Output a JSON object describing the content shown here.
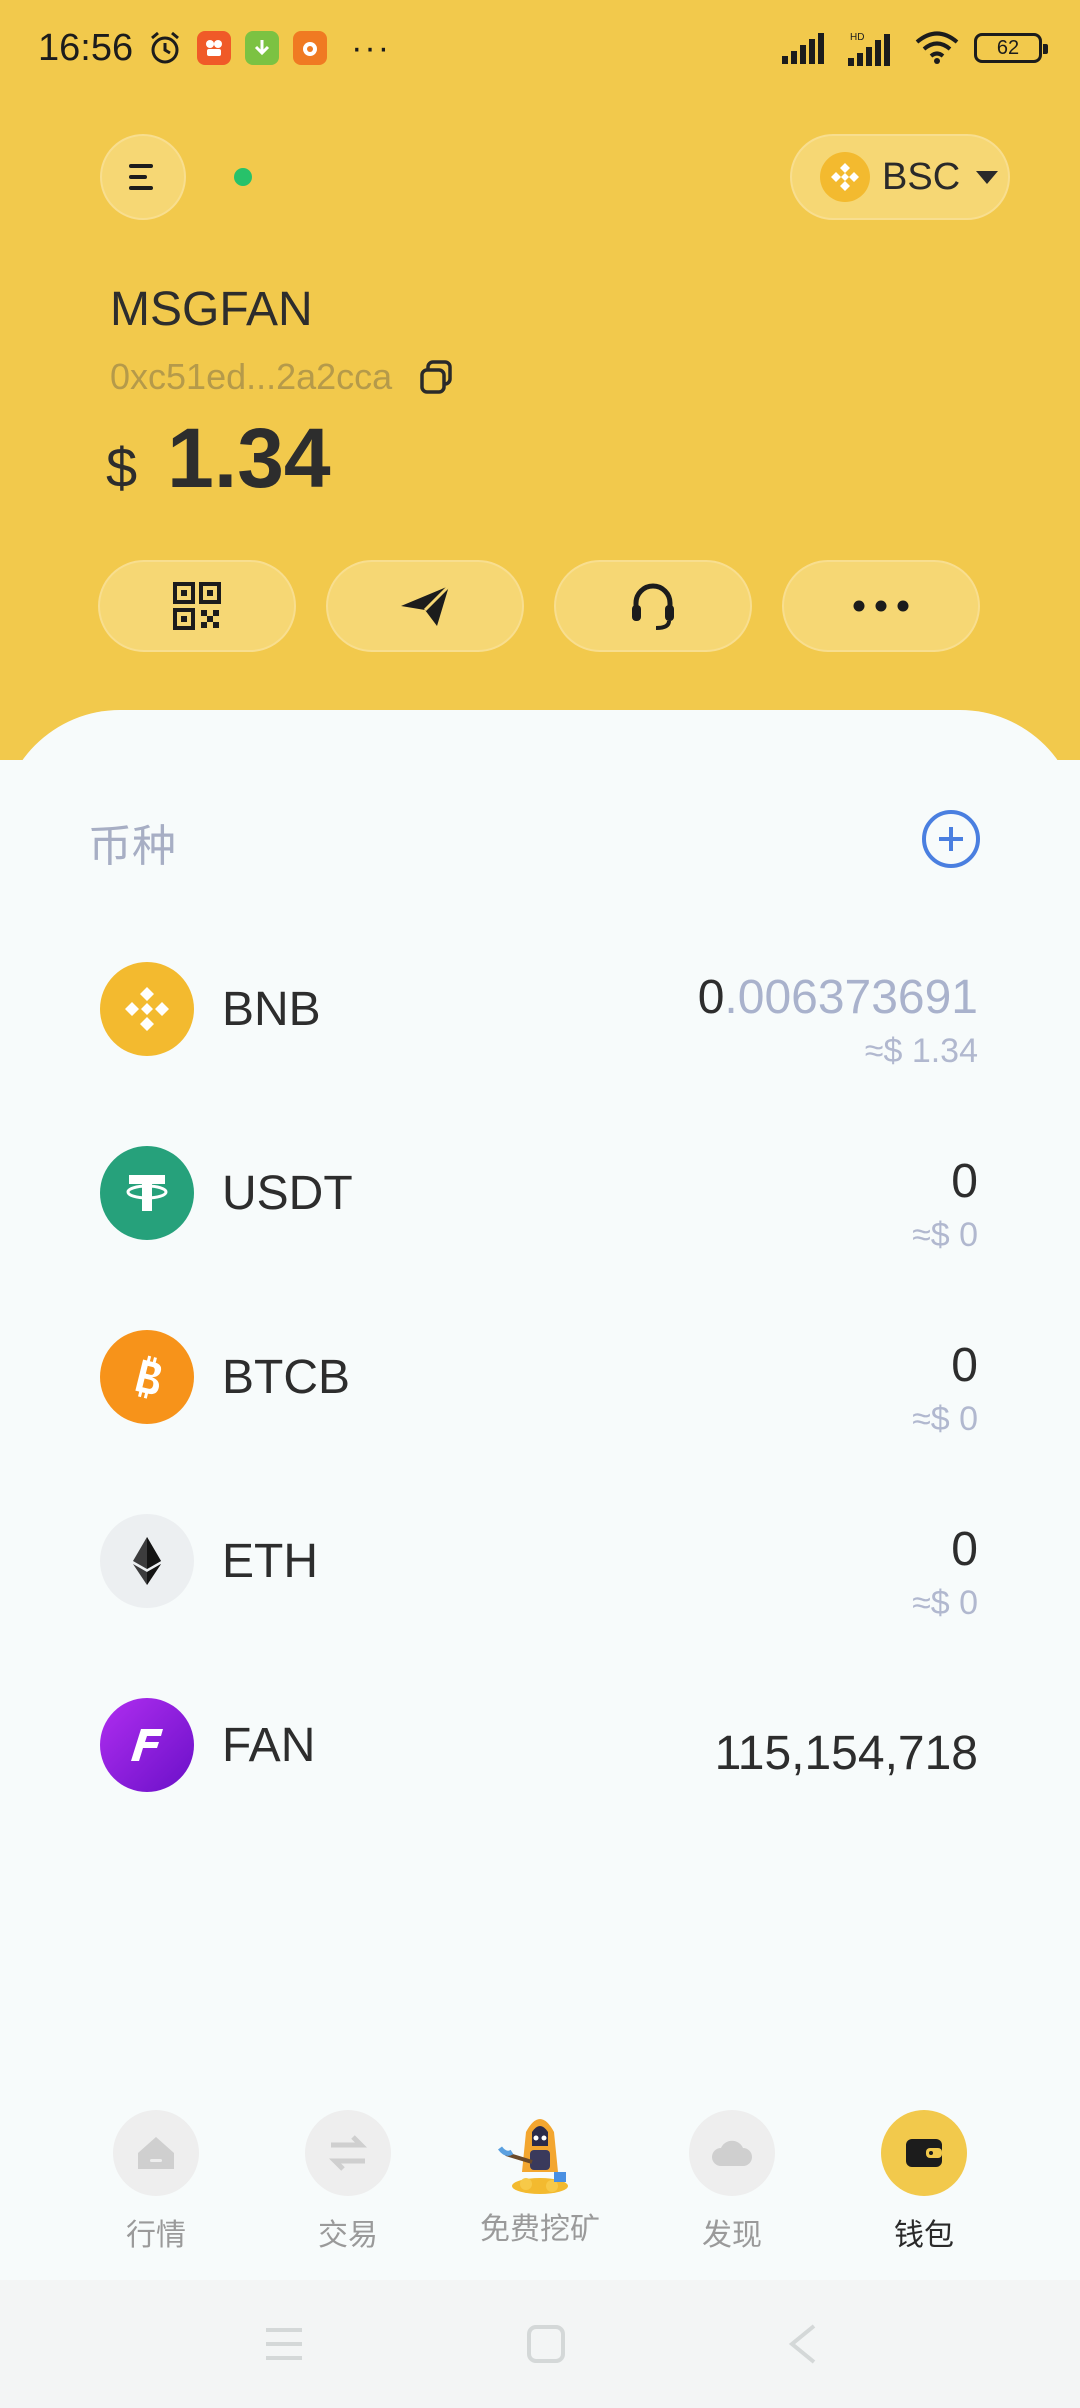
{
  "status_bar": {
    "time": "16:56",
    "more_dots": "···",
    "battery": "62"
  },
  "header": {
    "network": "BSC",
    "wallet_name": "MSGFAN",
    "address": "0xc51ed...2a2cca",
    "balance_currency": "$",
    "balance_value": "1.34",
    "colors": {
      "background": "#F2C94C",
      "online": "#27C26A"
    }
  },
  "actions": [
    {
      "name": "qr-code-icon"
    },
    {
      "name": "send-icon"
    },
    {
      "name": "support-headset-icon"
    },
    {
      "name": "more-icon"
    }
  ],
  "tokens": {
    "title": "币种",
    "items": [
      {
        "symbol": "BNB",
        "amount_int": "0",
        "amount_dec": ".006373691",
        "fiat": "≈$ 1.34",
        "color": "#F3BA2F"
      },
      {
        "symbol": "USDT",
        "amount_int": "0",
        "amount_dec": "",
        "fiat": "≈$ 0",
        "color": "#26A17B"
      },
      {
        "symbol": "BTCB",
        "amount_int": "0",
        "amount_dec": "",
        "fiat": "≈$ 0",
        "color": "#F7931A"
      },
      {
        "symbol": "ETH",
        "amount_int": "0",
        "amount_dec": "",
        "fiat": "≈$ 0",
        "color": "#ECEFF1"
      },
      {
        "symbol": "FAN",
        "amount_int": "115,154,718",
        "amount_dec": "",
        "fiat": "",
        "color": "#8A1FE0"
      }
    ]
  },
  "bottom_nav": [
    {
      "label": "行情",
      "icon": "home-icon",
      "active": false
    },
    {
      "label": "交易",
      "icon": "swap-icon",
      "active": false
    },
    {
      "label": "免费挖矿",
      "icon": "mining-character-icon",
      "active": false
    },
    {
      "label": "发现",
      "icon": "cloud-icon",
      "active": false
    },
    {
      "label": "钱包",
      "icon": "wallet-icon",
      "active": true
    }
  ]
}
